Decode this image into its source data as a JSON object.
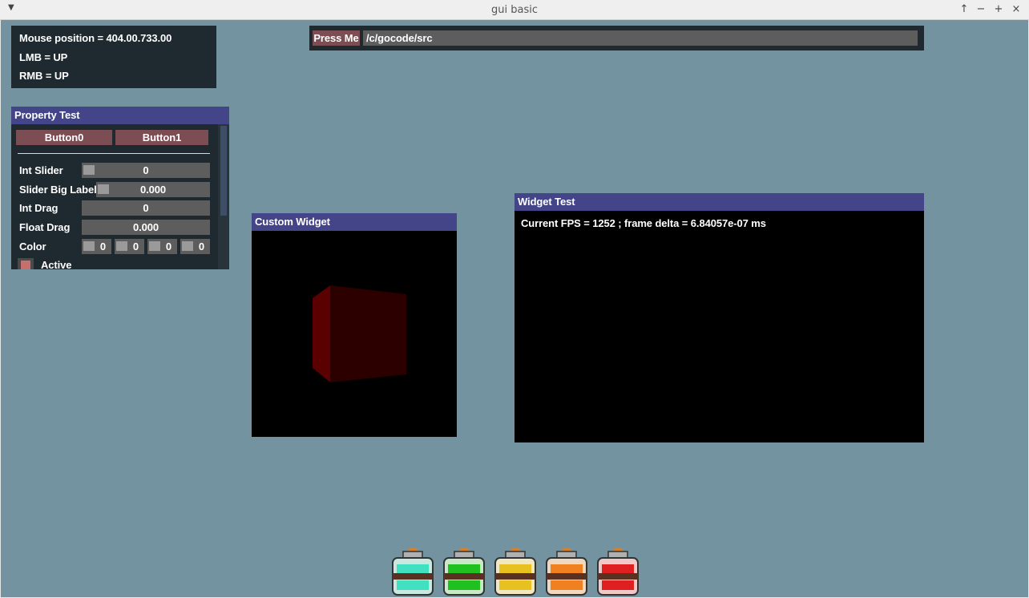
{
  "window": {
    "title": "gui basic",
    "controls": [
      "↑",
      "−",
      "+",
      "×"
    ]
  },
  "mouse_panel": {
    "position": "Mouse position = 404.00.733.00",
    "lmb": "LMB = UP",
    "rmb": "RMB = UP"
  },
  "topbar": {
    "button_label": "Press Me",
    "path_value": "/c/gocode/src"
  },
  "property_panel": {
    "title": "Property Test",
    "button0": "Button0",
    "button1": "Button1",
    "rows": {
      "int_slider": {
        "label": "Int Slider",
        "value": "0"
      },
      "slider_big": {
        "label": "Slider Big Label",
        "value": "0.000"
      },
      "int_drag": {
        "label": "Int Drag",
        "value": "0"
      },
      "float_drag": {
        "label": "Float Drag",
        "value": "0.000"
      },
      "color": {
        "label": "Color",
        "values": [
          "0",
          "0",
          "0",
          "0"
        ]
      },
      "active": {
        "label": "Active"
      }
    }
  },
  "custom_widget": {
    "title": "Custom Widget"
  },
  "widget_test": {
    "title": "Widget Test",
    "fps_text": "Current FPS = 1252 ; frame delta = 6.84057e-07 ms"
  },
  "dock": {
    "icons": [
      {
        "name": "cyan-jar-icon",
        "color": "#40e0c0"
      },
      {
        "name": "green-jar-icon",
        "color": "#20c020"
      },
      {
        "name": "yellow-jar-icon",
        "color": "#e8c020"
      },
      {
        "name": "orange-jar-icon",
        "color": "#f08020"
      },
      {
        "name": "red-jar-icon",
        "color": "#e02020"
      }
    ]
  },
  "colors": {
    "background": "#7393a0",
    "panel": "#1f2a30",
    "header": "#444488",
    "button": "#7c4d53",
    "field": "#5d5d5d"
  }
}
